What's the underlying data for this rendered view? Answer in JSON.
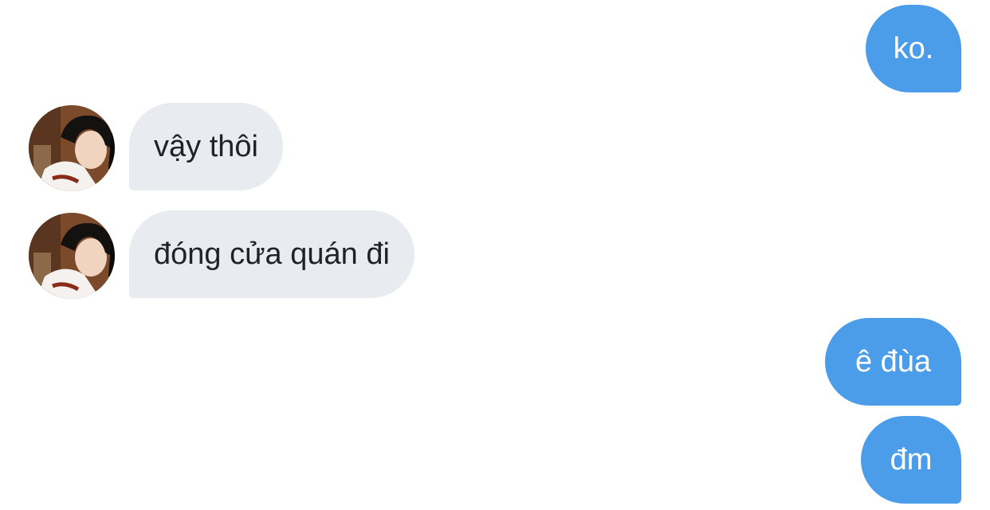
{
  "conversation": {
    "messages": [
      {
        "sender": "me",
        "text": "ko."
      },
      {
        "sender": "contact",
        "text": "vậy thôi"
      },
      {
        "sender": "contact",
        "text": "đóng cửa quán đi"
      },
      {
        "sender": "me",
        "text": "ê đùa"
      },
      {
        "sender": "me",
        "text": "đm"
      }
    ]
  },
  "contact": {
    "avatar": "profile-photo"
  },
  "colors": {
    "outgoing_bubble": "#4c9de9",
    "incoming_bubble": "#e8ebef",
    "outgoing_text": "#ffffff",
    "incoming_text": "#1f2328",
    "background": "#ffffff"
  }
}
